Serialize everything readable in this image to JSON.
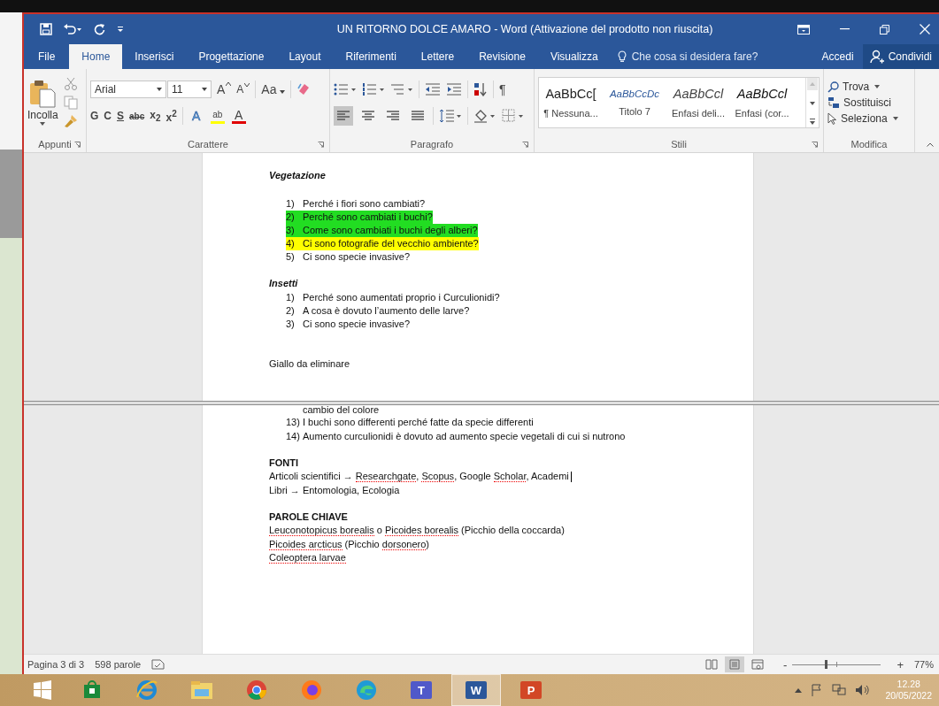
{
  "title_bar": {
    "title": "UN RITORNO DOLCE AMARO - Word (Attivazione del prodotto non riuscita)"
  },
  "tabs": [
    {
      "label": "File",
      "selected": false
    },
    {
      "label": "Home",
      "selected": true
    },
    {
      "label": "Inserisci",
      "selected": false
    },
    {
      "label": "Progettazione",
      "selected": false
    },
    {
      "label": "Layout",
      "selected": false
    },
    {
      "label": "Riferimenti",
      "selected": false
    },
    {
      "label": "Lettere",
      "selected": false
    },
    {
      "label": "Revisione",
      "selected": false
    },
    {
      "label": "Visualizza",
      "selected": false
    }
  ],
  "tell_me": {
    "placeholder": "Che cosa si desidera fare?"
  },
  "account": {
    "sign_in": "Accedi",
    "share": "Condividi"
  },
  "ribbon": {
    "clipboard": {
      "paste": "Incolla",
      "group": "Appunti"
    },
    "font": {
      "name": "Arial",
      "size": "11",
      "grow": "A",
      "shrink": "A",
      "case": "Aa",
      "group": "Carattere",
      "format_buttons": [
        {
          "label": "G",
          "kind": "bold"
        },
        {
          "label": "C",
          "kind": "italic"
        },
        {
          "label": "S",
          "kind": "underline"
        },
        {
          "label": "abc",
          "kind": "strike"
        },
        {
          "label": "x$_{2}$",
          "kind": "plain"
        },
        {
          "label": "x$^{2}$",
          "kind": "plain"
        }
      ],
      "color_buttons": [
        {
          "label": "A",
          "kind": "effects",
          "color": "#5b9bd5"
        },
        {
          "label": "ab",
          "kind": "highlight",
          "color": "#ffff00"
        },
        {
          "label": "A",
          "kind": "font-color",
          "color": "#e00000"
        }
      ]
    },
    "paragraph": {
      "group": "Paragrafo",
      "marks": "¶",
      "alignments": [
        {
          "selected": true
        },
        {
          "selected": false
        },
        {
          "selected": false
        },
        {
          "selected": false
        }
      ]
    },
    "styles": {
      "group": "Stili",
      "items": [
        {
          "preview": "AaBbCc[",
          "name": "¶ Nessuna...",
          "kind": "normal"
        },
        {
          "preview": "AaBbCcDc",
          "name": "Titolo 7",
          "kind": "heading"
        },
        {
          "preview": "AaBbCcl",
          "name": "Enfasi deli...",
          "kind": "subtle"
        },
        {
          "preview": "AaBbCcl",
          "name": "Enfasi (cor...",
          "kind": "strong"
        }
      ]
    },
    "editing": {
      "group": "Modifica",
      "find": "Trova",
      "replace": "Sostituisci",
      "select": "Seleziona"
    }
  },
  "document": {
    "top_sections": [
      {
        "heading": "Vegetazione",
        "items": [
          {
            "number": "1)",
            "text": "Perché i fiori sono cambiati?"
          },
          {
            "number": "2)",
            "text": "Perché sono cambiati i buchi?",
            "color": "#22dd22"
          },
          {
            "number": "3)",
            "text": "Come sono cambiati i buchi degli alberi?",
            "color": "#22dd22"
          },
          {
            "number": "4)",
            "text": "Ci sono fotografie del vecchio ambiente?",
            "color": "#ffff00"
          },
          {
            "number": "5)",
            "text": "Ci sono specie invasive?"
          }
        ]
      },
      {
        "heading": "Insetti",
        "items": [
          {
            "number": "1)",
            "text": "Perché sono aumentati proprio i Curculionidi?"
          },
          {
            "number": "2)",
            "text": "A cosa è dovuto l’aumento delle larve?"
          },
          {
            "number": "3)",
            "text": "Ci sono specie invasive?"
          }
        ]
      }
    ],
    "note": "Giallo da eliminare",
    "continued_text": "cambio del colore",
    "bottom_items": [
      {
        "number": "13)",
        "text": "I buchi sono differenti perché fatte da specie differenti"
      },
      {
        "number": "14)",
        "text": "Aumento curculionidi è dovuto ad aumento specie vegetali di cui si nutrono"
      }
    ],
    "sections": [
      {
        "title": "FONTI",
        "lines": [
          [
            {
              "text": "Articoli scientifici → ",
              "misspelled": false
            },
            {
              "text": "Researchgate",
              "misspelled": true
            },
            {
              "text": ", ",
              "misspelled": false
            },
            {
              "text": "Scopus",
              "misspelled": true
            },
            {
              "text": ", Google ",
              "misspelled": false
            },
            {
              "text": "Scholar",
              "misspelled": true
            },
            {
              "text": ", Academi",
              "misspelled": false
            }
          ],
          [
            {
              "text": "Libri → Entomologia, Ecologia",
              "misspelled": false
            }
          ]
        ]
      },
      {
        "title": "PAROLE CHIAVE",
        "lines": [
          [
            {
              "text": "Leuconotopicus borealis",
              "misspelled": true
            },
            {
              "text": " o ",
              "misspelled": false
            },
            {
              "text": "Picoides borealis",
              "misspelled": true
            },
            {
              "text": " (Picchio della coccarda)",
              "misspelled": false
            }
          ],
          [
            {
              "text": "Picoides arcticus",
              "misspelled": true
            },
            {
              "text": " (Picchio ",
              "misspelled": false
            },
            {
              "text": "dorsonero",
              "misspelled": true
            },
            {
              "text": ")",
              "misspelled": false
            }
          ],
          [
            {
              "text": "Coleoptera larvae",
              "misspelled": true
            }
          ]
        ]
      }
    ]
  },
  "status_bar": {
    "page": "Pagina 3 di 3",
    "words": "598 parole",
    "views": [
      {
        "selected": false
      },
      {
        "selected": true
      },
      {
        "selected": false
      }
    ],
    "zoom": {
      "minus": "-",
      "plus": "+",
      "level": 0.38,
      "percent": "77%"
    }
  },
  "taskbar": {
    "apps": [
      {
        "selected": false
      },
      {
        "selected": false
      },
      {
        "selected": false
      },
      {
        "selected": false
      },
      {
        "selected": false
      },
      {
        "selected": false
      },
      {
        "selected": false
      },
      {
        "selected": false,
        "label": "T"
      },
      {
        "selected": true,
        "label": "W"
      },
      {
        "selected": false,
        "label": "P"
      }
    ],
    "time": "12.28",
    "date": "20/05/2022"
  }
}
